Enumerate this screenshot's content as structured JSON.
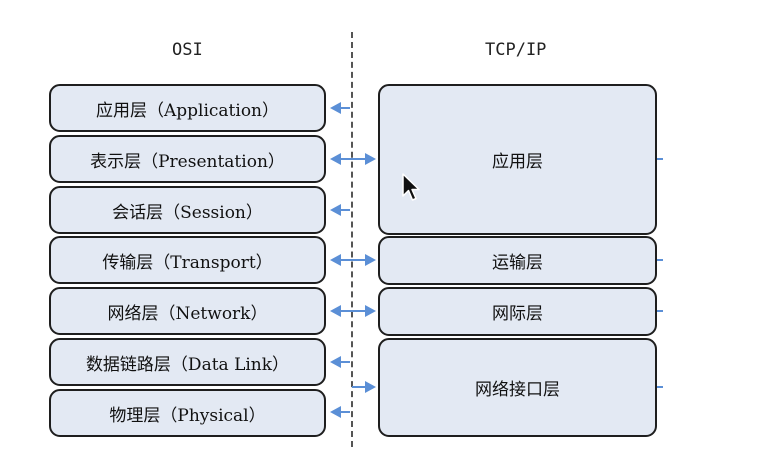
{
  "titles": {
    "osi": "OSI",
    "tcpip": "TCP/IP"
  },
  "osi_layers": [
    {
      "label": "应用层（Application）"
    },
    {
      "label": "表示层（Presentation）"
    },
    {
      "label": "会话层（Session）"
    },
    {
      "label": "传输层（Transport）"
    },
    {
      "label": "网络层（Network）"
    },
    {
      "label": "数据链路层（Data Link）"
    },
    {
      "label": "物理层（Physical）"
    }
  ],
  "tcpip_layers": [
    {
      "label": "应用层"
    },
    {
      "label": "运输层"
    },
    {
      "label": "网际层"
    },
    {
      "label": "网络接口层"
    }
  ],
  "colors": {
    "arrow": "#5b8fd6",
    "box_fill": "#e3e9f3",
    "border": "#1e1e1e"
  }
}
